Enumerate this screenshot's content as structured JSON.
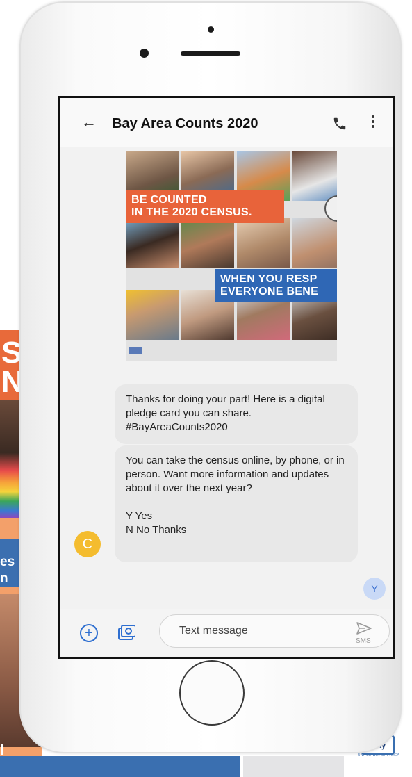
{
  "background": {
    "poster_text_1": "S\nN",
    "poster_text_2": "es\nn",
    "poster_text_3": "l"
  },
  "logo": {
    "box_text": "Way",
    "subtitle": "UNITED WAY BAY AREA"
  },
  "app": {
    "title": "Bay Area Counts 2020",
    "back_icon": "arrow-left-icon",
    "call_icon": "phone-icon",
    "menu_icon": "more-vert-icon"
  },
  "image": {
    "banner_top": "BE COUNTED\nIN THE 2020 CENSUS.",
    "banner_bottom": "WHEN YOU RESP\nEVERYONE BENE"
  },
  "messages": [
    {
      "text": "Thanks for doing your part! Here is a digital pledge card you can share. #BayAreaCounts2020"
    },
    {
      "paragraph1": "You can take the census online, by phone, or in person. Want more information and updates about it over the next year?",
      "option1": "Y Yes",
      "option2": "N No Thanks"
    }
  ],
  "sender": {
    "initial": "C",
    "color": "#f4bc2f"
  },
  "reply": {
    "initial": "Y",
    "color": "#c9d9f6"
  },
  "composer": {
    "placeholder": "Text message",
    "send_type": "SMS",
    "add_icon": "add-circle-icon",
    "camera_icon": "camera-icon",
    "send_icon": "send-icon"
  }
}
